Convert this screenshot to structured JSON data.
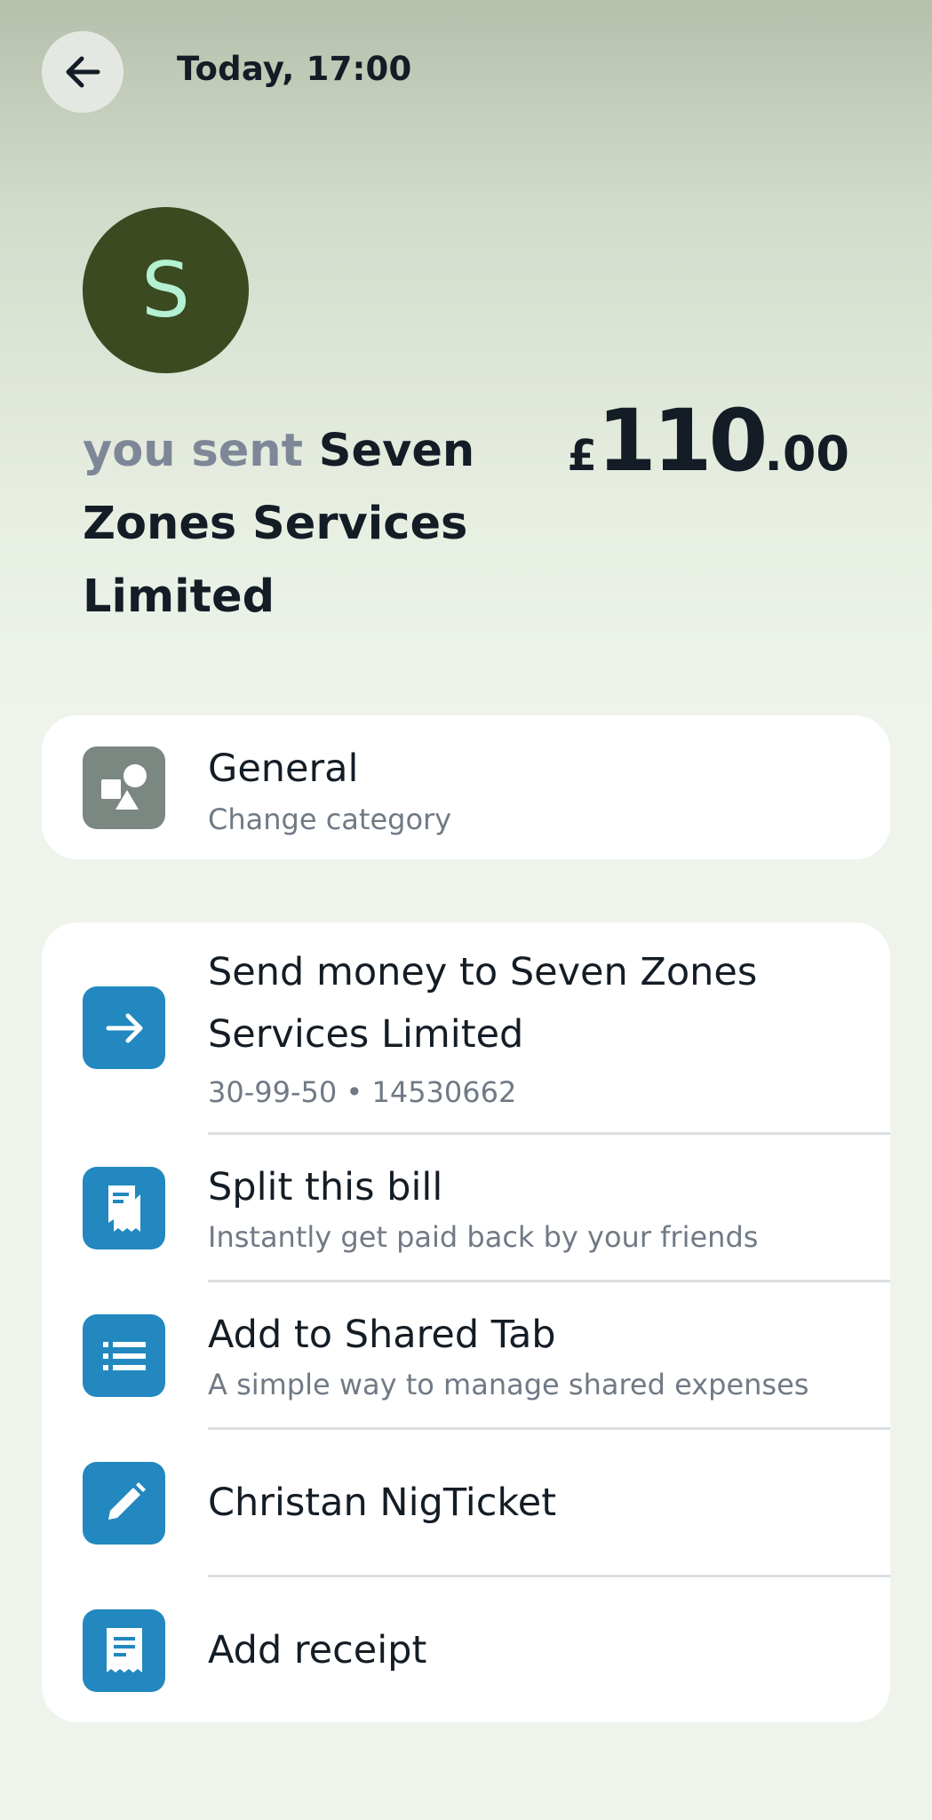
{
  "header": {
    "title": "Today, 17:00"
  },
  "payee": {
    "avatar_letter": "S",
    "prefix": "you sent",
    "name": "Seven Zones Services Limited"
  },
  "amount": {
    "currency": "£",
    "whole": "110",
    "decimal": ".00"
  },
  "category": {
    "title": "General",
    "subtitle": "Change category"
  },
  "actions": [
    {
      "title": "Send money to Seven Zones Services Limited",
      "subtitle": "30-99-50 • 14530662",
      "icon": "arrow-right-icon"
    },
    {
      "title": "Split this bill",
      "subtitle": "Instantly get paid back by your friends",
      "icon": "split-bill-icon"
    },
    {
      "title": "Add to Shared Tab",
      "subtitle": "A simple way to manage shared expenses",
      "icon": "list-icon"
    },
    {
      "title": "Christan NigTicket",
      "icon": "pencil-icon"
    },
    {
      "title": "Add receipt",
      "icon": "receipt-icon"
    }
  ],
  "colors": {
    "accent": "#2288bf",
    "avatar_bg": "#3b4a20",
    "avatar_fg": "#b4f0d2",
    "category_icon_bg": "#7b8781"
  }
}
